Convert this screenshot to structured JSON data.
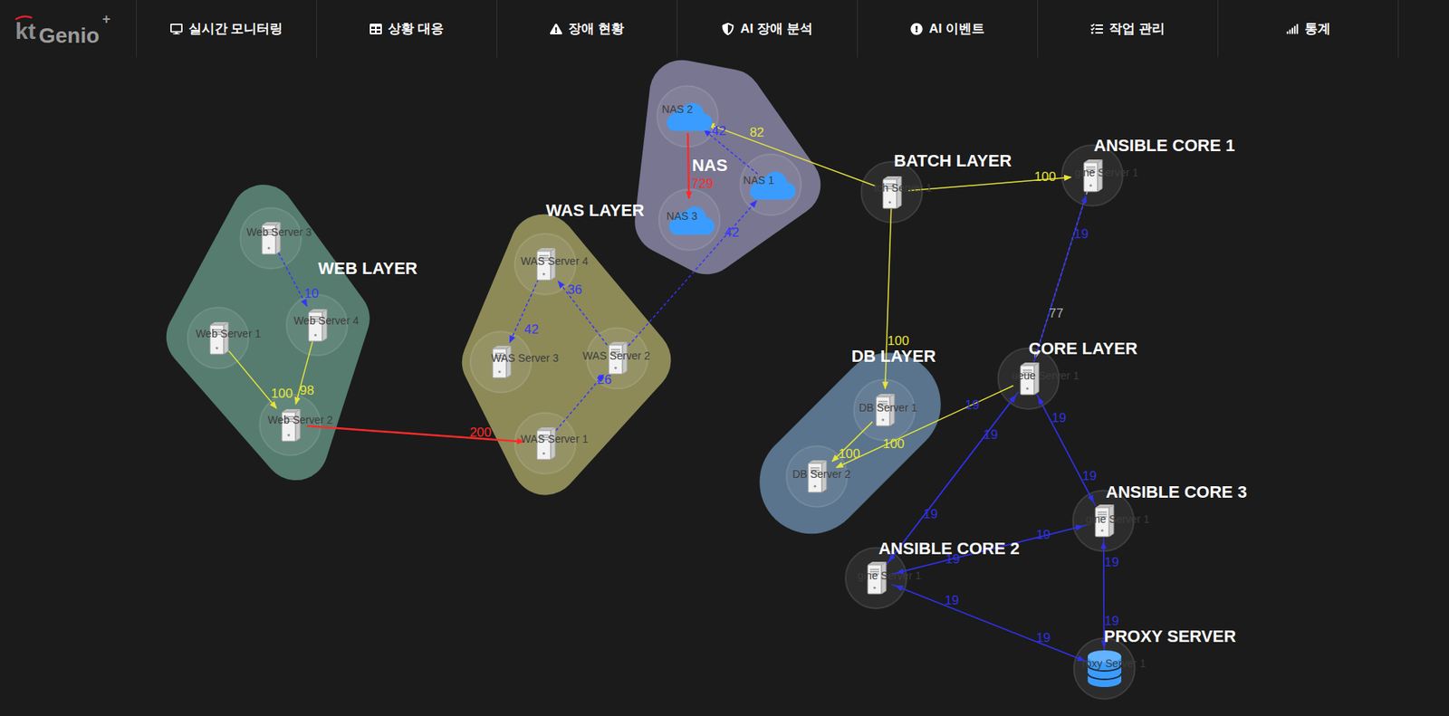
{
  "logo": {
    "brand": "kt",
    "name": "Genio",
    "mark": "+"
  },
  "nav": [
    {
      "label": "실시간 모니터링"
    },
    {
      "label": "상황 대응"
    },
    {
      "label": "장애 현황"
    },
    {
      "label": "AI 장애 분석"
    },
    {
      "label": "AI 이벤트"
    },
    {
      "label": "작업 관리"
    },
    {
      "label": "통계"
    }
  ],
  "groups": [
    {
      "label": "WEB LAYER",
      "kind": "cluster",
      "color": "#557c6f"
    },
    {
      "label": "WAS LAYER",
      "kind": "cluster",
      "color": "#8d8a58"
    },
    {
      "label": "NAS",
      "kind": "cluster",
      "color": "#787691"
    },
    {
      "label": "DB LAYER",
      "kind": "cluster",
      "color": "#59748c"
    },
    {
      "label": "BATCH LAYER",
      "kind": "single"
    },
    {
      "label": "ANSIBLE CORE 1",
      "kind": "single"
    },
    {
      "label": "CORE LAYER",
      "kind": "single"
    },
    {
      "label": "ANSIBLE CORE 3",
      "kind": "single"
    },
    {
      "label": "ANSIBLE CORE 2",
      "kind": "single"
    },
    {
      "label": "PROXY SERVER",
      "kind": "single"
    }
  ],
  "nodes": [
    {
      "label": "Web Server 3",
      "kind": "server"
    },
    {
      "label": "Web Server 4",
      "kind": "server"
    },
    {
      "label": "Web Server 1",
      "kind": "server"
    },
    {
      "label": "Web Server 2",
      "kind": "server"
    },
    {
      "label": "WAS Server 4",
      "kind": "server"
    },
    {
      "label": "WAS Server 3",
      "kind": "server"
    },
    {
      "label": "WAS Server 2",
      "kind": "server"
    },
    {
      "label": "WAS Server 1",
      "kind": "server"
    },
    {
      "label": "NAS 2",
      "kind": "nas"
    },
    {
      "label": "NAS 1",
      "kind": "nas"
    },
    {
      "label": "NAS 3",
      "kind": "nas"
    },
    {
      "label": "tch Server 1",
      "kind": "server"
    },
    {
      "label": "gine Server 1",
      "kind": "server"
    },
    {
      "label": "ueue Server 1",
      "kind": "server"
    },
    {
      "label": "DB Server 1",
      "kind": "server"
    },
    {
      "label": "DB Server 2",
      "kind": "server"
    },
    {
      "label": "gine Server 1",
      "kind": "server"
    },
    {
      "label": "gine Server 1",
      "kind": "server"
    },
    {
      "label": "roxy Server 1",
      "kind": "database"
    }
  ],
  "edges": [
    {
      "from": 0,
      "to": 1,
      "label": "10",
      "color": "#3434ff",
      "dashed": true
    },
    {
      "from": 1,
      "to": 3,
      "label": "98",
      "color": "#e8e43a",
      "dashed": false
    },
    {
      "from": 2,
      "to": 3,
      "label": "100",
      "color": "#e8e43a",
      "dashed": false
    },
    {
      "from": 3,
      "to": 7,
      "label": "200",
      "color": "#ff2a2a",
      "dashed": false
    },
    {
      "from": 6,
      "to": 4,
      "label": "36",
      "color": "#3434ff",
      "dashed": true
    },
    {
      "from": 4,
      "to": 5,
      "label": "42",
      "color": "#3434ff",
      "dashed": true
    },
    {
      "from": 7,
      "to": 6,
      "label": "26",
      "color": "#3434ff",
      "dashed": true
    },
    {
      "from": 6,
      "to": 9,
      "label": "42",
      "color": "#3434ff",
      "dashed": true
    },
    {
      "from": 9,
      "to": 8,
      "label": "42",
      "color": "#3434ff",
      "dashed": true
    },
    {
      "from": 8,
      "to": 10,
      "label": "729",
      "color": "#ff2a2a",
      "dashed": false
    },
    {
      "from": 11,
      "to": 8,
      "label": "82",
      "color": "#e8e43a",
      "dashed": false
    },
    {
      "from": 11,
      "to": 12,
      "label": "100",
      "color": "#e8e43a",
      "dashed": false
    },
    {
      "from": 11,
      "to": 14,
      "label": "100",
      "color": "#e8e43a",
      "dashed": false
    },
    {
      "from": 13,
      "to": 15,
      "label": "100",
      "color": "#e8e43a",
      "dashed": false
    },
    {
      "from": 14,
      "to": 15,
      "label": "100",
      "color": "#e8e43a",
      "dashed": false
    },
    {
      "from": 12,
      "to": 13,
      "label": "77",
      "color": "#b0b0b0",
      "dashed": true
    },
    {
      "from": 13,
      "to": 12,
      "label": "19",
      "color": "#3030e0",
      "dashed": false
    },
    {
      "from": 16,
      "to": 13,
      "label": "19",
      "color": "#3030e0",
      "dashed": false
    },
    {
      "from": 16,
      "to": 13,
      "label": "19",
      "color": "#3030e0",
      "dashed": false
    },
    {
      "from": 13,
      "to": 16,
      "label": "19",
      "color": "#3030e0",
      "dashed": false
    },
    {
      "from": 13,
      "to": 17,
      "label": "19",
      "color": "#3030e0",
      "dashed": false
    },
    {
      "from": 17,
      "to": 13,
      "label": "19",
      "color": "#3030e0",
      "dashed": false
    },
    {
      "from": 16,
      "to": 17,
      "label": "19",
      "color": "#3030e0",
      "dashed": false
    },
    {
      "from": 17,
      "to": 16,
      "label": "19",
      "color": "#3030e0",
      "dashed": false
    },
    {
      "from": 17,
      "to": 18,
      "label": "19",
      "color": "#3030e0",
      "dashed": false
    },
    {
      "from": 18,
      "to": 17,
      "label": "19",
      "color": "#3030e0",
      "dashed": false
    },
    {
      "from": 16,
      "to": 18,
      "label": "19",
      "color": "#3030e0",
      "dashed": false
    },
    {
      "from": 18,
      "to": 16,
      "label": "19",
      "color": "#3030e0",
      "dashed": false
    }
  ]
}
